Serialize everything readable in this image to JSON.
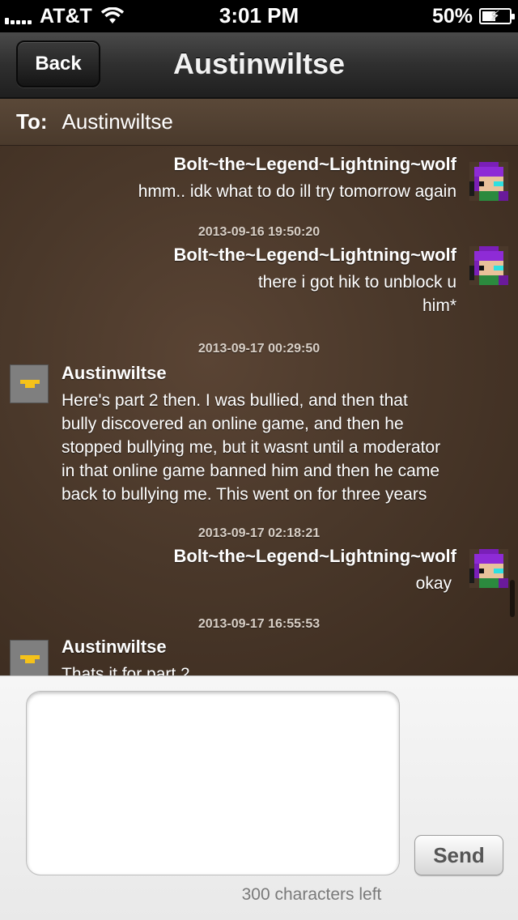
{
  "status": {
    "carrier": "AT&T",
    "time": "3:01 PM",
    "battery": "50%"
  },
  "nav": {
    "back_label": "Back",
    "title": "Austinwiltse"
  },
  "recipient": {
    "label": "To:",
    "name": "Austinwiltse"
  },
  "messages": [
    {
      "direction": "out",
      "sender": "Bolt~the~Legend~Lightning~wolf",
      "lines": [
        "hmm.. idk what to do ill try tomorrow again"
      ]
    },
    {
      "timestamp": "2013-09-16 19:50:20",
      "direction": "out",
      "sender": "Bolt~the~Legend~Lightning~wolf",
      "lines": [
        "there i got hik to unblock u",
        "him*"
      ]
    },
    {
      "timestamp": "2013-09-17 00:29:50",
      "direction": "in",
      "sender": "Austinwiltse",
      "lines": [
        "Here's part 2 then. I was bullied, and then that",
        "bully discovered an online game, and then he",
        "stopped bullying me, but it wasnt until a moderator",
        "in that online game banned him and then he came",
        "back to bullying me. This went on for three years"
      ]
    },
    {
      "timestamp": "2013-09-17 02:18:21",
      "direction": "out",
      "sender": "Bolt~the~Legend~Lightning~wolf",
      "lines": [
        "okay"
      ]
    },
    {
      "timestamp": "2013-09-17 16:55:53",
      "direction": "in",
      "sender": "Austinwiltse",
      "lines": [
        "Thats it for part 2"
      ]
    }
  ],
  "compose": {
    "value": "",
    "send_label": "Send",
    "char_count": "300 characters left"
  }
}
